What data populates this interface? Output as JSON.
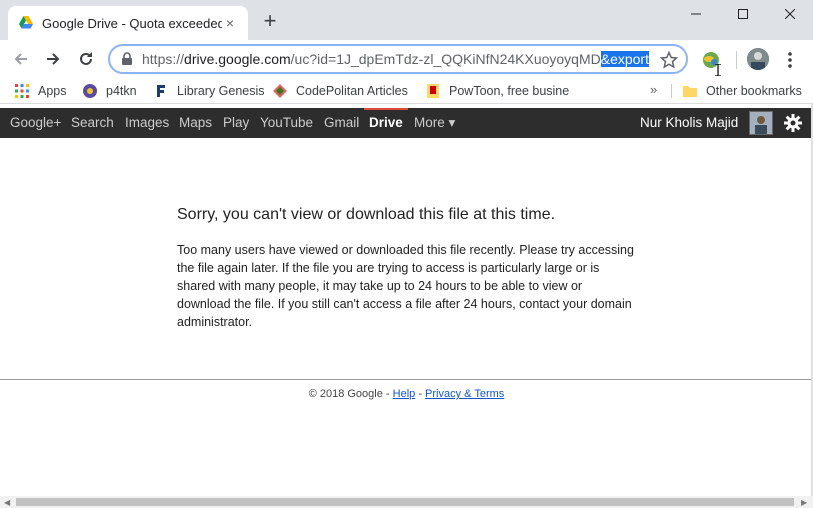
{
  "tab": {
    "title": "Google Drive - Quota exceeded",
    "close": "×"
  },
  "new_tab": "+",
  "address": {
    "scheme": "https://",
    "host": "drive.google.com",
    "path": "/uc?id=1J_dpEmTdz-zl_QQKiNfN24KXuoyoyqMD",
    "selected": "&export"
  },
  "bookmarks": [
    {
      "label": "Apps"
    },
    {
      "label": "p4tkn"
    },
    {
      "label": "Library Genesis"
    },
    {
      "label": "CodePolitan Articles"
    },
    {
      "label": "PowToon, free busine"
    }
  ],
  "bookmarks_overflow": "»",
  "other_bookmarks": "Other bookmarks",
  "gbar": {
    "items": [
      "Google+",
      "Search",
      "Images",
      "Maps",
      "Play",
      "YouTube",
      "Gmail",
      "Drive",
      "More ▾"
    ],
    "active": "Drive",
    "user": "Nur Kholis Majid"
  },
  "message": {
    "heading": "Sorry, you can't view or download this file at this time.",
    "body": "Too many users have viewed or downloaded this file recently. Please try accessing the file again later. If the file you are trying to access is particularly large or is shared with many people, it may take up to 24 hours to be able to view or download the file. If you still can't access a file after 24 hours, contact your domain administrator."
  },
  "footer": {
    "copyright": "© 2018 Google",
    "sep": " - ",
    "help": "Help",
    "privacy": "Privacy & Terms"
  },
  "colors": {
    "gbar_bg": "#2d2d2d",
    "active_accent": "#dd4b39",
    "link": "#1155cc",
    "selection": "#1a73e8"
  }
}
